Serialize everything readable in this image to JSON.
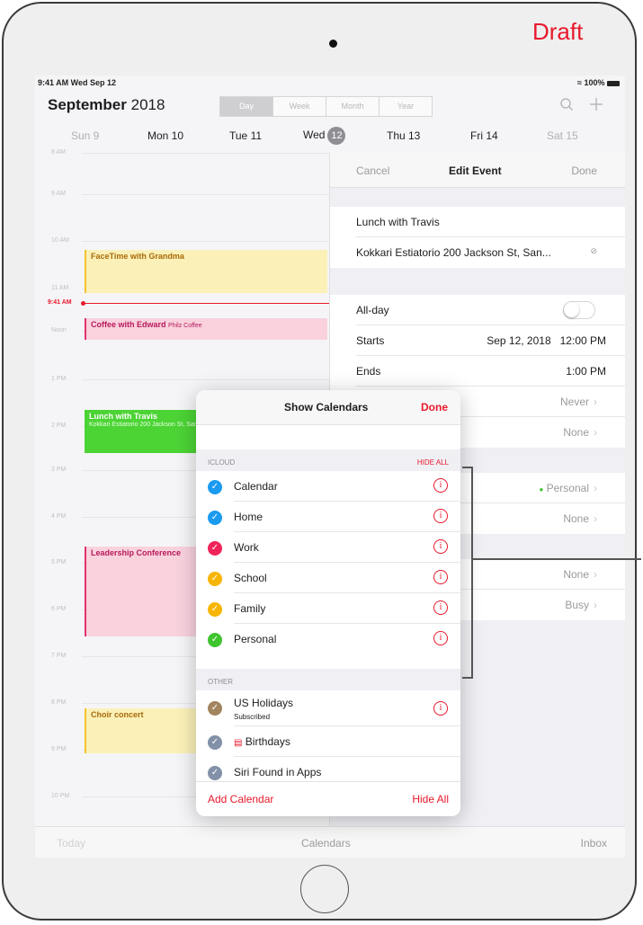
{
  "annotation": {
    "draft_label": "Draft"
  },
  "status_bar": {
    "time": "9:41 AM  Wed Sep 12",
    "battery": "100%"
  },
  "header": {
    "month": "September",
    "year": "2018",
    "segments": [
      "Day",
      "Week",
      "Month",
      "Year"
    ],
    "active_segment": "Day"
  },
  "week": {
    "days": [
      {
        "label": "Sun 9",
        "dim": true
      },
      {
        "label": "Mon 10"
      },
      {
        "label": "Tue 11"
      },
      {
        "label": "Wed",
        "today_num": "12"
      },
      {
        "label": "Thu 13"
      },
      {
        "label": "Fri 14"
      },
      {
        "label": "Sat 15",
        "dim": true
      }
    ]
  },
  "timeline": {
    "hours": [
      "8 AM",
      "9 AM",
      "10 AM",
      "11 AM",
      "Noon",
      "1 PM",
      "2 PM",
      "3 PM",
      "4 PM",
      "5 PM",
      "6 PM",
      "7 PM",
      "8 PM",
      "9 PM",
      "10 PM"
    ],
    "now_label": "9:41 AM",
    "events": {
      "facetime": {
        "title": "FaceTime with Grandma"
      },
      "coffee": {
        "title": "Coffee with Edward",
        "location": "Philz Coffee"
      },
      "lunch": {
        "title": "Lunch with Travis",
        "location": "Kokkari Estiatorio 200 Jackson St, San Francisco, CA 94111, United States"
      },
      "leadership": {
        "title": "Leadership Conference"
      },
      "choir": {
        "title": "Choir concert"
      }
    }
  },
  "edit_event": {
    "cancel": "Cancel",
    "title": "Edit Event",
    "done": "Done",
    "event_title": "Lunch with Travis",
    "location": "Kokkari Estiatorio 200 Jackson St, San...",
    "all_day_label": "All-day",
    "starts_label": "Starts",
    "starts_value": "Sep 12, 2018   12:00 PM",
    "ends_label": "Ends",
    "ends_value": "1:00 PM",
    "repeat_value": "Never",
    "travel_value": "None",
    "calendar_value": "Personal",
    "invitees_value": "None",
    "alert_value": "None",
    "show_as_value": "Busy"
  },
  "bottom_bar": {
    "today": "Today",
    "calendars": "Calendars",
    "inbox": "Inbox"
  },
  "show_calendars": {
    "title": "Show Calendars",
    "done": "Done",
    "icloud_header": "ICLOUD",
    "hide_all_header": "HIDE ALL",
    "icloud": [
      {
        "name": "Calendar",
        "color": "#1a9bf0"
      },
      {
        "name": "Home",
        "color": "#1a9bf0"
      },
      {
        "name": "Work",
        "color": "#f0245a"
      },
      {
        "name": "School",
        "color": "#f7b500"
      },
      {
        "name": "Family",
        "color": "#f7b500"
      },
      {
        "name": "Personal",
        "color": "#3ec52e"
      }
    ],
    "other_header": "OTHER",
    "other": [
      {
        "name": "US Holidays",
        "sub": "Subscribed",
        "color": "#a2845e"
      },
      {
        "name": "Birthdays",
        "color": "#8291a8"
      },
      {
        "name": "Siri Found in Apps",
        "color": "#8291a8"
      }
    ],
    "add_calendar": "Add Calendar",
    "hide_all": "Hide All"
  }
}
